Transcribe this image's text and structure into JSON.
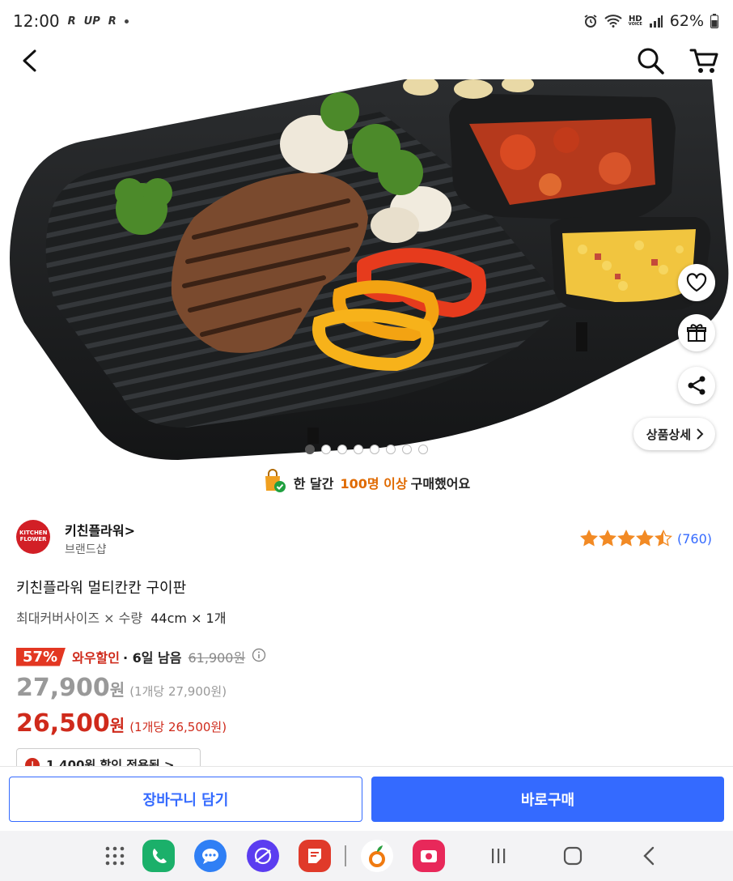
{
  "status_bar": {
    "time": "12:00",
    "indicators": [
      "R",
      "UP",
      "R"
    ],
    "battery": "62%",
    "icons": [
      "alarm-icon",
      "wifi-icon",
      "hd-voice-icon",
      "signal-icon",
      "battery-icon"
    ]
  },
  "header": {
    "back_icon": "back-arrow-icon",
    "search_icon": "search-icon",
    "cart_icon": "cart-icon"
  },
  "hero": {
    "image_count": 8,
    "active_index": 0,
    "detail_label": "상품상세"
  },
  "social_proof": {
    "prefix": "한 달간",
    "highlight": "100명 이상",
    "suffix": "구매했어요"
  },
  "seller": {
    "logo_text": "KITCHEN FLOWER",
    "name": "키친플라워>",
    "type": "브랜드샵",
    "rating": 4.5,
    "review_count": "(760)"
  },
  "product": {
    "title": "키친플라워 멀티칸칸 구이판",
    "option_label": "최대커버사이즈 × 수량",
    "option_value": "44cm × 1개"
  },
  "pricing": {
    "discount_rate": "57%",
    "wow_label": "와우할인",
    "remaining": "· 6일 남음",
    "original_price": "61,900원",
    "sale_price": "27,900",
    "sale_won": "원",
    "sale_unit": "(1개당 27,900원)",
    "wow_price": "26,500",
    "wow_won": "원",
    "wow_unit": "(1개당 26,500원)",
    "coupon_text": "1,400원  할인 적용됨  >"
  },
  "actions": {
    "cart_button": "장바구니 담기",
    "buy_button": "바로구매"
  },
  "colors": {
    "accent_blue": "#346aff",
    "sale_red": "#cf2a1b",
    "badge_red": "#e33722",
    "highlight_orange": "#e06a00"
  }
}
